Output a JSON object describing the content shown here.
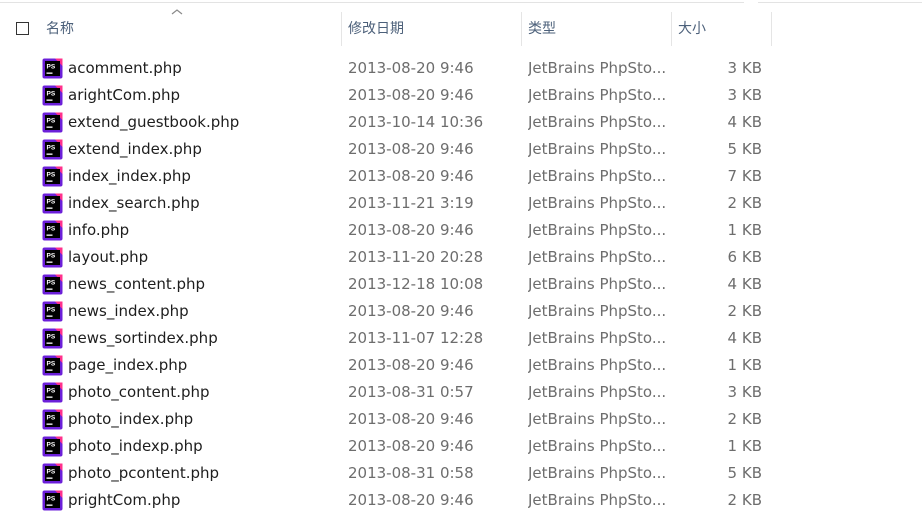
{
  "header": {
    "name_label": "名称",
    "date_label": "修改日期",
    "type_label": "类型",
    "size_label": "大小"
  },
  "icon": {
    "name": "phpstorm-file-icon",
    "label": "PS",
    "colors": {
      "outer": "#6b1fd8",
      "accent": "#ff318c",
      "inner": "#000000",
      "text": "#ffffff"
    }
  },
  "files": [
    {
      "name": "acomment.php",
      "date": "2013-08-20 9:46",
      "type": "JetBrains PhpSto...",
      "size": "3 KB"
    },
    {
      "name": "arightCom.php",
      "date": "2013-08-20 9:46",
      "type": "JetBrains PhpSto...",
      "size": "3 KB"
    },
    {
      "name": "extend_guestbook.php",
      "date": "2013-10-14 10:36",
      "type": "JetBrains PhpSto...",
      "size": "4 KB"
    },
    {
      "name": "extend_index.php",
      "date": "2013-08-20 9:46",
      "type": "JetBrains PhpSto...",
      "size": "5 KB"
    },
    {
      "name": "index_index.php",
      "date": "2013-08-20 9:46",
      "type": "JetBrains PhpSto...",
      "size": "7 KB"
    },
    {
      "name": "index_search.php",
      "date": "2013-11-21 3:19",
      "type": "JetBrains PhpSto...",
      "size": "2 KB"
    },
    {
      "name": "info.php",
      "date": "2013-08-20 9:46",
      "type": "JetBrains PhpSto...",
      "size": "1 KB"
    },
    {
      "name": "layout.php",
      "date": "2013-11-20 20:28",
      "type": "JetBrains PhpSto...",
      "size": "6 KB"
    },
    {
      "name": "news_content.php",
      "date": "2013-12-18 10:08",
      "type": "JetBrains PhpSto...",
      "size": "4 KB"
    },
    {
      "name": "news_index.php",
      "date": "2013-08-20 9:46",
      "type": "JetBrains PhpSto...",
      "size": "2 KB"
    },
    {
      "name": "news_sortindex.php",
      "date": "2013-11-07 12:28",
      "type": "JetBrains PhpSto...",
      "size": "4 KB"
    },
    {
      "name": "page_index.php",
      "date": "2013-08-20 9:46",
      "type": "JetBrains PhpSto...",
      "size": "1 KB"
    },
    {
      "name": "photo_content.php",
      "date": "2013-08-31 0:57",
      "type": "JetBrains PhpSto...",
      "size": "3 KB"
    },
    {
      "name": "photo_index.php",
      "date": "2013-08-20 9:46",
      "type": "JetBrains PhpSto...",
      "size": "2 KB"
    },
    {
      "name": "photo_indexp.php",
      "date": "2013-08-20 9:46",
      "type": "JetBrains PhpSto...",
      "size": "1 KB"
    },
    {
      "name": "photo_pcontent.php",
      "date": "2013-08-31 0:58",
      "type": "JetBrains PhpSto...",
      "size": "5 KB"
    },
    {
      "name": "prightCom.php",
      "date": "2013-08-20 9:46",
      "type": "JetBrains PhpSto...",
      "size": "2 KB"
    }
  ]
}
